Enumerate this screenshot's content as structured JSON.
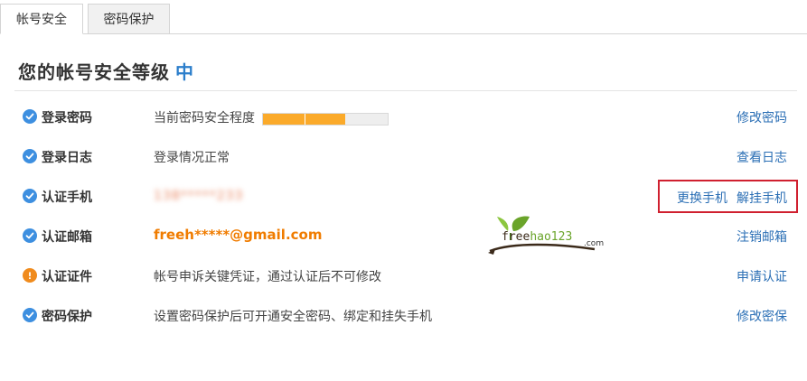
{
  "tabs": [
    {
      "label": "帐号安全",
      "active": true
    },
    {
      "label": "密码保护",
      "active": false
    }
  ],
  "title": {
    "text": "您的帐号安全等级",
    "level": "中",
    "level_color": "#2b7ecb"
  },
  "rows": [
    {
      "label": "登录密码",
      "status": "ok",
      "desc": "当前密码安全程度",
      "strength": 0.66,
      "action": "修改密码"
    },
    {
      "label": "登录日志",
      "status": "ok",
      "desc": "登录情况正常",
      "action": "查看日志"
    },
    {
      "label": "认证手机",
      "status": "ok",
      "value": "138*****233",
      "actions": [
        "更换手机",
        "解挂手机"
      ]
    },
    {
      "label": "认证邮箱",
      "status": "ok",
      "value": "freeh*****@gmail.com",
      "action": "注销邮箱"
    },
    {
      "label": "认证证件",
      "status": "warn",
      "desc": "帐号申诉关键凭证，通过认证后不可修改",
      "action": "申请认证"
    },
    {
      "label": "密码保护",
      "status": "ok",
      "desc": "设置密码保护后可开通安全密码、绑定和挂失手机",
      "action": "修改密保"
    }
  ],
  "watermark": {
    "text_a": "free",
    "text_b": "hao123",
    "suffix": ".com"
  },
  "colors": {
    "link": "#2b6fb5",
    "ok_icon": "#3d8fe0",
    "warn_icon": "#f08b1d",
    "strength_fill": "#fbaa2a",
    "email": "#f07c00",
    "highlight_border": "#d0202f"
  }
}
